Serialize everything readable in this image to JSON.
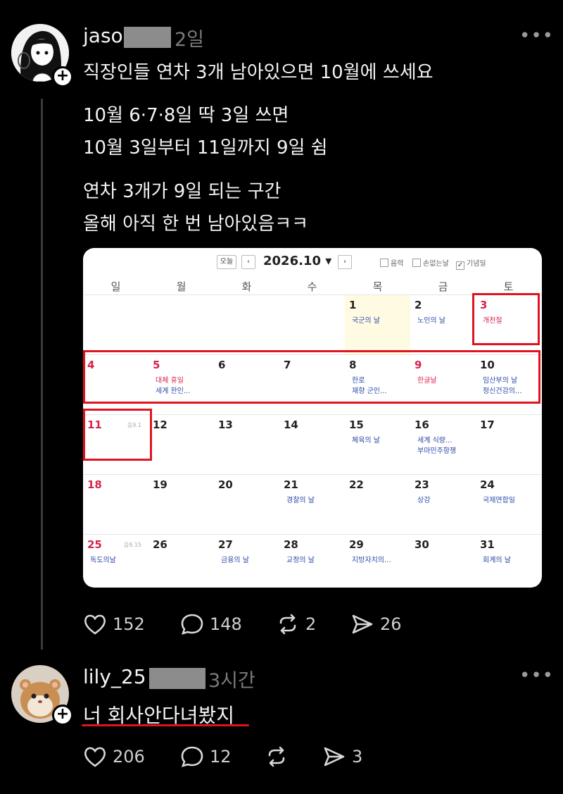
{
  "post": {
    "username": "jaso",
    "time": "2일",
    "more": "•••",
    "lines": [
      "직장인들 연차 3개 남아있으면 10월에 쓰세요",
      "10월 6·7·8일 딱 3일 쓰면",
      "10월 3일부터 11일까지 9일 쉼",
      "연차 3개가 9일 되는 구간",
      "올해 아직 한 번 남아있음ㅋㅋ"
    ],
    "likes": "152",
    "comments": "148",
    "reposts": "2",
    "shares": "26"
  },
  "calendar": {
    "today_btn": "오늘",
    "prev": "‹",
    "next": "›",
    "title": "2026.10 ▾",
    "checks": [
      {
        "label": "음력",
        "checked": false
      },
      {
        "label": "손없는날",
        "checked": false
      },
      {
        "label": "기념일",
        "checked": true
      }
    ],
    "weekdays": [
      "일",
      "월",
      "화",
      "수",
      "목",
      "금",
      "토"
    ],
    "weeks": [
      [
        {
          "num": "",
          "red": false,
          "events": []
        },
        {
          "num": "",
          "red": false,
          "events": []
        },
        {
          "num": "",
          "red": false,
          "events": []
        },
        {
          "num": "",
          "red": false,
          "events": []
        },
        {
          "num": "1",
          "red": false,
          "events": [
            {
              "text": "국군의 날",
              "red": false
            }
          ]
        },
        {
          "num": "2",
          "red": false,
          "events": [
            {
              "text": "노인의 날",
              "red": false
            }
          ]
        },
        {
          "num": "3",
          "red": true,
          "events": [
            {
              "text": "개천절",
              "red": true
            }
          ]
        }
      ],
      [
        {
          "num": "4",
          "red": true,
          "events": []
        },
        {
          "num": "5",
          "red": true,
          "events": [
            {
              "text": "대체 휴일",
              "red": true
            },
            {
              "text": "세계 한인...",
              "red": false
            }
          ]
        },
        {
          "num": "6",
          "red": false,
          "events": []
        },
        {
          "num": "7",
          "red": false,
          "events": []
        },
        {
          "num": "8",
          "red": false,
          "events": [
            {
              "text": "한로",
              "red": false
            },
            {
              "text": "재향 군인...",
              "red": false
            }
          ]
        },
        {
          "num": "9",
          "red": true,
          "events": [
            {
              "text": "한글날",
              "red": true
            }
          ]
        },
        {
          "num": "10",
          "red": false,
          "events": [
            {
              "text": "임산부의 날",
              "red": false
            },
            {
              "text": "정신건강의...",
              "red": false
            }
          ]
        }
      ],
      [
        {
          "num": "11",
          "red": true,
          "lunar": "음9.1",
          "events": []
        },
        {
          "num": "12",
          "red": false,
          "events": []
        },
        {
          "num": "13",
          "red": false,
          "events": []
        },
        {
          "num": "14",
          "red": false,
          "events": []
        },
        {
          "num": "15",
          "red": false,
          "events": [
            {
              "text": "체육의 날",
              "red": false
            }
          ]
        },
        {
          "num": "16",
          "red": false,
          "events": [
            {
              "text": "세계 식량...",
              "red": false
            },
            {
              "text": "부마민주항쟁",
              "red": false
            }
          ]
        },
        {
          "num": "17",
          "red": false,
          "events": []
        }
      ],
      [
        {
          "num": "18",
          "red": true,
          "events": []
        },
        {
          "num": "19",
          "red": false,
          "events": []
        },
        {
          "num": "20",
          "red": false,
          "events": []
        },
        {
          "num": "21",
          "red": false,
          "events": [
            {
              "text": "경찰의 날",
              "red": false
            }
          ]
        },
        {
          "num": "22",
          "red": false,
          "events": []
        },
        {
          "num": "23",
          "red": false,
          "events": [
            {
              "text": "상강",
              "red": false
            }
          ]
        },
        {
          "num": "24",
          "red": false,
          "events": [
            {
              "text": "국제연합일",
              "red": false
            }
          ]
        }
      ],
      [
        {
          "num": "25",
          "red": true,
          "lunar": "음9.15",
          "events": [
            {
              "text": "독도의날",
              "red": false
            }
          ]
        },
        {
          "num": "26",
          "red": false,
          "events": []
        },
        {
          "num": "27",
          "red": false,
          "events": [
            {
              "text": "금융의 날",
              "red": false
            }
          ]
        },
        {
          "num": "28",
          "red": false,
          "events": [
            {
              "text": "교정의 날",
              "red": false
            }
          ]
        },
        {
          "num": "29",
          "red": false,
          "events": [
            {
              "text": "지방자치의...",
              "red": false
            }
          ]
        },
        {
          "num": "30",
          "red": false,
          "events": []
        },
        {
          "num": "31",
          "red": false,
          "events": [
            {
              "text": "회계의 날",
              "red": false
            }
          ]
        }
      ]
    ]
  },
  "reply": {
    "username": "lily_25",
    "time": "3시간",
    "more": "•••",
    "text": "너 회사안다녀봤지",
    "likes": "206",
    "comments": "12",
    "reposts": "",
    "shares": "3"
  },
  "colors": {
    "background": "#000000",
    "highlight": "#e0141e",
    "holiday": "#d6234a",
    "event": "#2b4aa6"
  }
}
